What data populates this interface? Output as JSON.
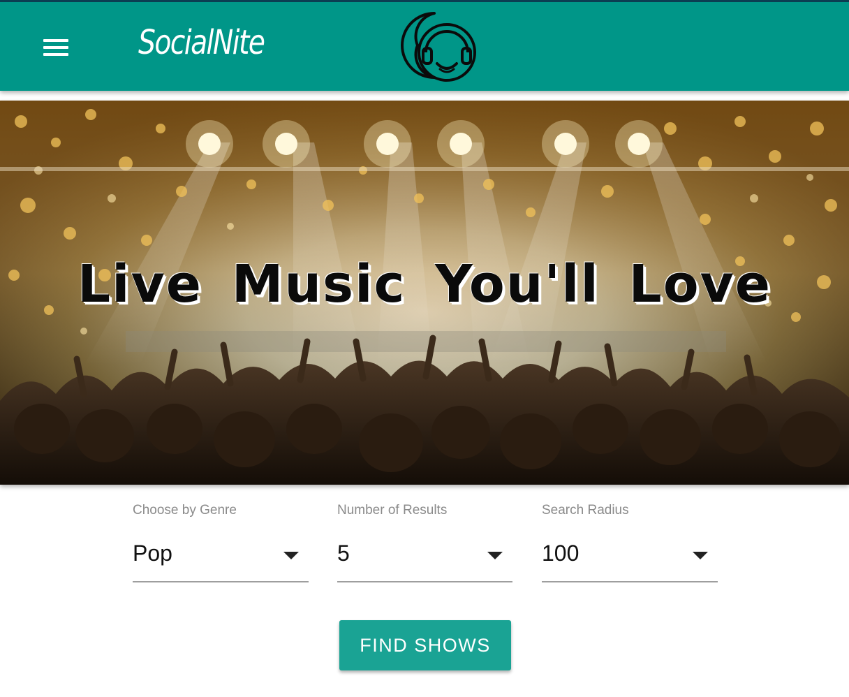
{
  "header": {
    "menu_icon": "hamburger-menu-icon",
    "brand_name": "SocialNite",
    "logo_icon": "moon-headphones-logo-icon",
    "background_color": "#009688"
  },
  "hero": {
    "image_description_icon": "concert-crowd-stage-lights-image",
    "headline": "Live Music You'll Love"
  },
  "filters": [
    {
      "label": "Choose by Genre",
      "value": "Pop",
      "icon": "dropdown-arrow-icon"
    },
    {
      "label": "Number of Results",
      "value": "5",
      "icon": "dropdown-arrow-icon"
    },
    {
      "label": "Search Radius",
      "value": "100",
      "icon": "dropdown-arrow-icon"
    }
  ],
  "actions": {
    "find_label": "FIND SHOWS",
    "button_color": "#1aa394"
  }
}
